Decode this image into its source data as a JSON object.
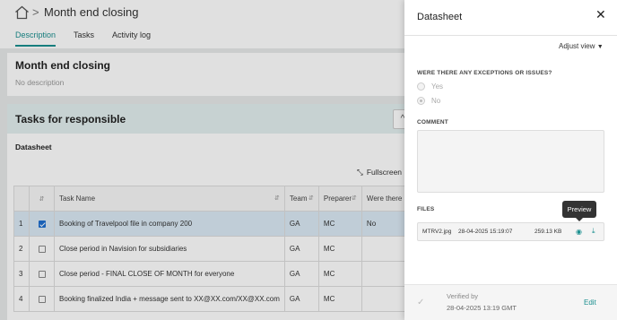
{
  "breadcrumb": {
    "separator": ">",
    "page_title": "Month end closing"
  },
  "tabs": [
    {
      "label": "Description",
      "active": true
    },
    {
      "label": "Tasks",
      "active": false
    },
    {
      "label": "Activity log",
      "active": false
    }
  ],
  "description_card": {
    "title": "Month end closing",
    "subtitle": "No description"
  },
  "tasks_card": {
    "title": "Tasks for responsible",
    "collapse_icon": "chevron-up-icon"
  },
  "datasheet": {
    "label": "Datasheet",
    "fullscreen_label": "Fullscreen"
  },
  "table": {
    "columns": [
      "",
      "",
      "Task Name",
      "Team",
      "Preparer",
      "Were there any ex"
    ],
    "rows": [
      {
        "num": "1",
        "checked": true,
        "task": "Booking of Travelpool file in company 200",
        "team": "GA",
        "preparer": "MC",
        "answer": "No"
      },
      {
        "num": "2",
        "checked": false,
        "task": "Close period in Navision for subsidiaries",
        "team": "GA",
        "preparer": "MC",
        "answer": ""
      },
      {
        "num": "3",
        "checked": false,
        "task": "Close period - FINAL CLOSE OF MONTH for everyone",
        "team": "GA",
        "preparer": "MC",
        "answer": ""
      },
      {
        "num": "4",
        "checked": false,
        "task": "Booking finalized India + message sent to XX@XX.com/XX@XX.com",
        "team": "GA",
        "preparer": "MC",
        "answer": ""
      }
    ]
  },
  "drawer": {
    "title": "Datasheet",
    "close_icon": "close-icon",
    "adjust_view": "Adjust view",
    "question": "WERE THERE ANY EXCEPTIONS OR ISSUES?",
    "options": [
      {
        "label": "Yes",
        "selected": false
      },
      {
        "label": "No",
        "selected": true
      }
    ],
    "comment_label": "COMMENT",
    "files_label": "FILES",
    "file": {
      "name": "MTRV2.jpg",
      "date": "28-04-2025 15:19:07",
      "size": "259.13 KB"
    },
    "tooltip": "Preview",
    "footer": {
      "verified_by": "Verified by",
      "verified_date": "28-04-2025 13:19 GMT",
      "edit": "Edit"
    }
  }
}
